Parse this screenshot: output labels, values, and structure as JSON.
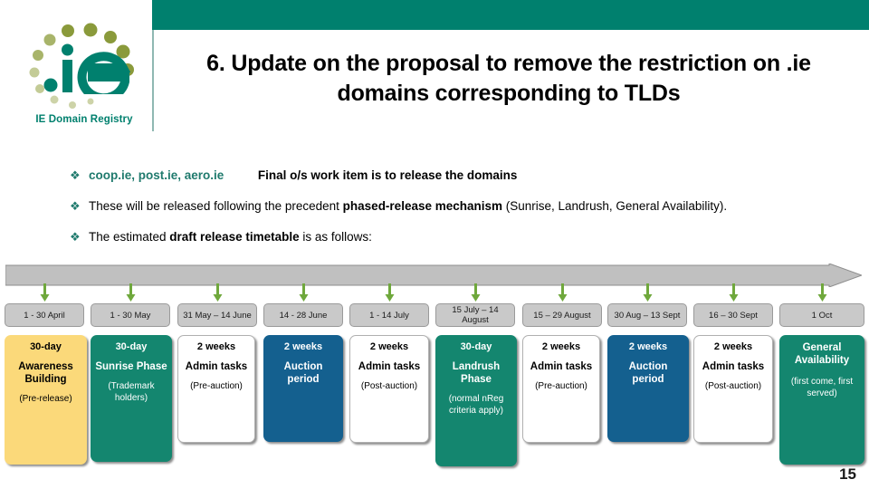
{
  "header": {
    "title": "6. Update on the proposal to remove the restriction on .ie domains corresponding to TLDs",
    "band_color": "#00806e"
  },
  "logo": {
    "wordmark": ".ie",
    "caption": "IE Domain Registry",
    "teal": "#00806e",
    "olive": "#8a9a3b"
  },
  "bullets": [
    {
      "marker": "❖",
      "lead": "coop.ie, post.ie, aero.ie",
      "rest": "Final o/s work item is to release the domains"
    },
    {
      "marker": "❖",
      "pre": "These will be released following the precedent ",
      "bold": "phased-release mechanism",
      "post": " (Sunrise, Landrush, General Availability)."
    },
    {
      "marker": "❖",
      "pre": "The estimated ",
      "bold": "draft release timetable",
      "post": " is as follows:"
    }
  ],
  "timeline": {
    "bar_color": "#c0c0c0",
    "bar_border": "#8e8e8e",
    "arrow_color": "#6fa83c",
    "dates": [
      "1 - 30 April",
      "1 - 30 May",
      "31 May – 14 June",
      "14 - 28 June",
      "1 - 14 July",
      "15 July – 14 August",
      "15 – 29 August",
      "30 Aug – 13 Sept",
      "16 – 30 Sept",
      "1 Oct"
    ]
  },
  "phases": [
    {
      "duration": "30-day",
      "name": "Awareness Building",
      "note": "(Pre-release)",
      "style": "gold"
    },
    {
      "duration": "30-day",
      "name": "Sunrise Phase",
      "note": "(Trademark holders)",
      "style": "teal"
    },
    {
      "duration": "2 weeks",
      "name": "Admin tasks",
      "note": "(Pre-auction)",
      "style": "white"
    },
    {
      "duration": "2 weeks",
      "name": "Auction period",
      "note": "",
      "style": "blue"
    },
    {
      "duration": "2 weeks",
      "name": "Admin tasks",
      "note": "(Post-auction)",
      "style": "white"
    },
    {
      "duration": "30-day",
      "name": "Landrush Phase",
      "note": "(normal nReg criteria apply)",
      "style": "teal"
    },
    {
      "duration": "2 weeks",
      "name": "Admin tasks",
      "note": "(Pre-auction)",
      "style": "white"
    },
    {
      "duration": "2 weeks",
      "name": "Auction period",
      "note": "",
      "style": "blue"
    },
    {
      "duration": "2 weeks",
      "name": "Admin tasks",
      "note": "(Post-auction)",
      "style": "white"
    },
    {
      "duration": "",
      "name": "General Availability",
      "note": "(first come, first served)",
      "style": "teal"
    }
  ],
  "phase_colors": {
    "gold": "#fbd97a",
    "teal": "#14866f",
    "blue": "#14608f",
    "white": "#ffffff"
  },
  "page_number": "15"
}
